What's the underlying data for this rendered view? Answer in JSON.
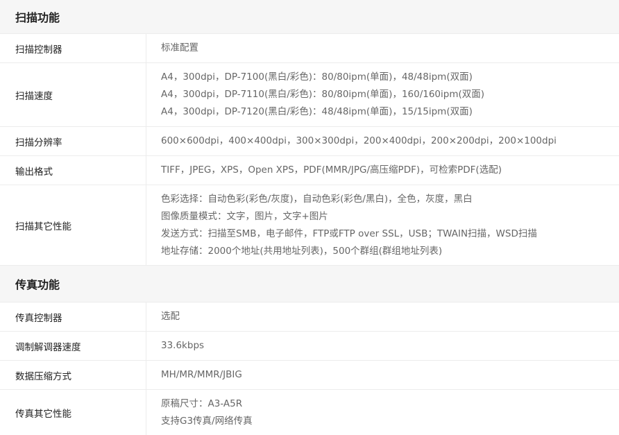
{
  "scan": {
    "title": "扫描功能",
    "rows": [
      {
        "label": "扫描控制器",
        "lines": [
          "标准配置"
        ]
      },
      {
        "label": "扫描速度",
        "lines": [
          "A4，300dpi，DP-7100(黑白/彩色)：80/80ipm(单面)，48/48ipm(双面)",
          "A4，300dpi，DP-7110(黑白/彩色)：80/80ipm(单面)，160/160ipm(双面)",
          "A4，300dpi，DP-7120(黑白/彩色)：48/48ipm(单面)，15/15ipm(双面)"
        ]
      },
      {
        "label": "扫描分辨率",
        "lines": [
          "600×600dpi，400×400dpi，300×300dpi，200×400dpi，200×200dpi，200×100dpi"
        ]
      },
      {
        "label": "输出格式",
        "lines": [
          "TIFF，JPEG，XPS，Open XPS，PDF(MMR/JPG/高压缩PDF)，可检索PDF(选配)"
        ]
      },
      {
        "label": "扫描其它性能",
        "lines": [
          "色彩选择：自动色彩(彩色/灰度)，自动色彩(彩色/黑白)，全色，灰度，黑白",
          "图像质量模式：文字，图片，文字+图片",
          "发送方式：扫描至SMB，电子邮件，FTP或FTP over SSL，USB；TWAIN扫描，WSD扫描",
          "地址存储：2000个地址(共用地址列表)，500个群组(群组地址列表)"
        ]
      }
    ]
  },
  "fax": {
    "title": "传真功能",
    "rows": [
      {
        "label": "传真控制器",
        "lines": [
          "选配"
        ]
      },
      {
        "label": "调制解调器速度",
        "lines": [
          "33.6kbps"
        ]
      },
      {
        "label": "数据压缩方式",
        "lines": [
          "MH/MR/MMR/JBIG"
        ]
      },
      {
        "label": "传真其它性能",
        "lines": [
          "原稿尺寸：A3-A5R",
          "支持G3传真/网络传真"
        ]
      }
    ]
  }
}
